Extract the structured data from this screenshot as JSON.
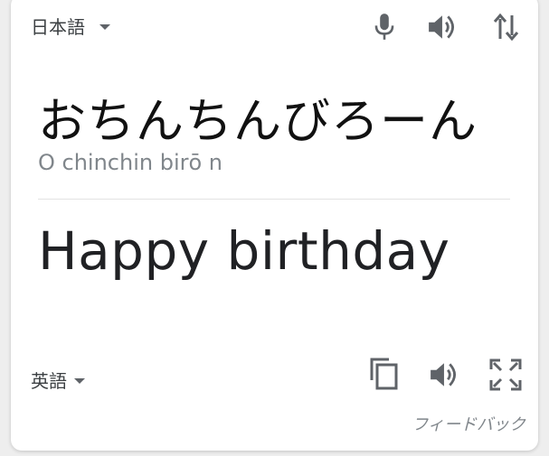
{
  "header": {
    "source_language": "日本語",
    "mic_icon": "microphone-icon",
    "speaker_icon": "volume-icon",
    "swap_icon": "swap-vertical-icon"
  },
  "source": {
    "text": "おちんちんびろーん",
    "romanization": "O chinchin birō n"
  },
  "translation": {
    "text": "Happy birthday",
    "target_language": "英語",
    "copy_icon": "copy-icon",
    "speaker_icon": "volume-icon",
    "fullscreen_icon": "fullscreen-icon"
  },
  "footer": {
    "feedback_label": "フィードバック"
  },
  "colors": {
    "icon": "#5f6368",
    "text_primary": "#202124",
    "text_secondary": "#80868b",
    "background": "#eeeeee",
    "card": "#ffffff"
  }
}
